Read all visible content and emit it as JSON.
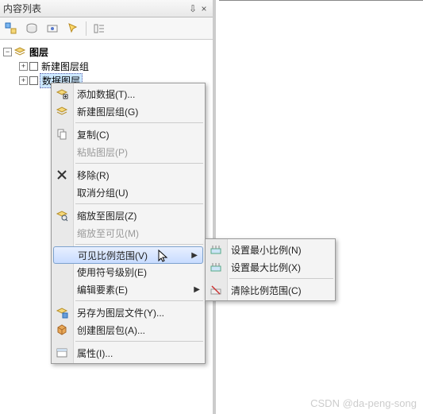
{
  "panel": {
    "title": "内容列表",
    "pin": "⇩",
    "close": "×"
  },
  "tree": {
    "root": "图层",
    "group": "新建图层组",
    "layer": "数据图层"
  },
  "menu": {
    "addData": "添加数据(T)...",
    "newGroup": "新建图层组(G)",
    "copy": "复制(C)",
    "paste": "粘贴图层(P)",
    "remove": "移除(R)",
    "ungroup": "取消分组(U)",
    "zoomLayer": "缩放至图层(Z)",
    "zoomVisible": "缩放至可见(M)",
    "visibleScale": "可见比例范围(V)",
    "useSymbolLevel": "使用符号级别(E)",
    "editFeatures": "编辑要素(E)",
    "saveAsLayer": "另存为图层文件(Y)...",
    "createPackage": "创建图层包(A)...",
    "properties": "属性(I)..."
  },
  "submenu": {
    "setMin": "设置最小比例(N)",
    "setMax": "设置最大比例(X)",
    "clear": "清除比例范围(C)"
  },
  "watermark": "CSDN @da-peng-song"
}
